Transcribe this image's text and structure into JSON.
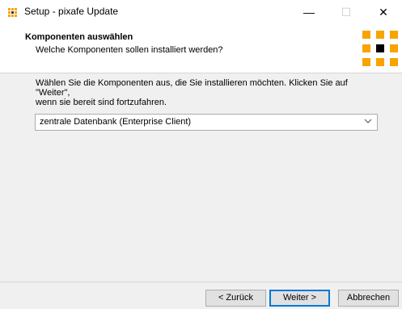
{
  "window": {
    "title": "Setup - pixafe Update",
    "minimize_glyph": "—",
    "maximize_glyph": "☐",
    "close_glyph": "✕"
  },
  "header": {
    "title": "Komponenten auswählen",
    "subtitle": "Welche Komponenten sollen installiert werden?"
  },
  "main": {
    "description_line1": "Wählen Sie die Komponenten aus, die Sie installieren möchten. Klicken Sie auf \"Weiter\",",
    "description_line2": "wenn sie bereit sind fortzufahren.",
    "components_select": {
      "selected": "zentrale Datenbank (Enterprise Client)"
    }
  },
  "buttons": {
    "back": "< Zurück",
    "next": "Weiter >",
    "cancel": "Abbrechen"
  },
  "colors": {
    "accent": "#f7a300",
    "focus_border": "#0078d7"
  }
}
